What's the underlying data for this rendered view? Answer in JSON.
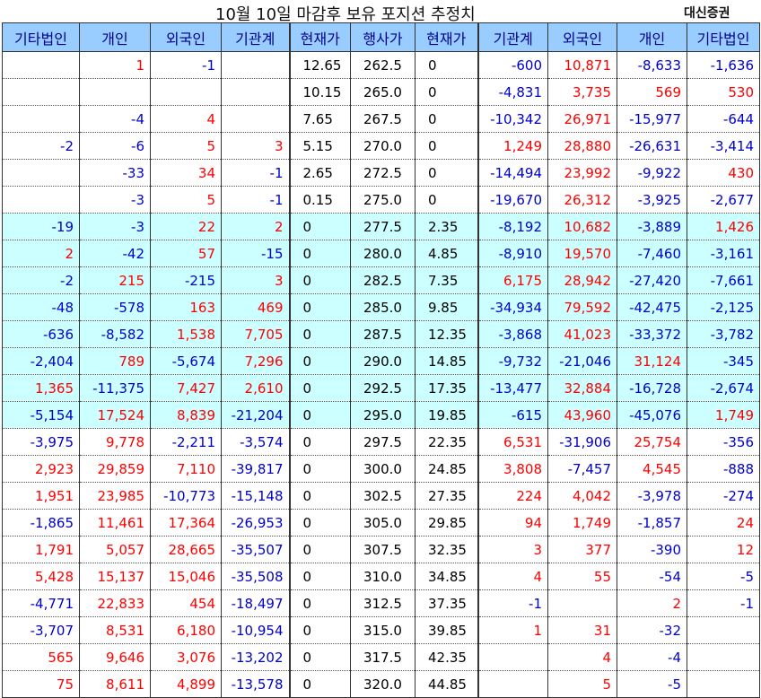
{
  "title": "10월 10일 마감후 보유 포지션 추정치",
  "source": "대신증권",
  "colors": {
    "header_bg": "#99ccff",
    "highlight_bg": "#ccffff",
    "positive": "#ff0000",
    "negative": "#0000cc"
  },
  "headers": [
    "기타법인",
    "개인",
    "외국인",
    "기관계",
    "현재가",
    "행사가",
    "현재가",
    "기관계",
    "외국인",
    "개인",
    "기타법인"
  ],
  "rows": [
    {
      "hl": false,
      "cells": [
        "",
        "1",
        "-1",
        "",
        "12.65",
        "262.5",
        "0",
        "-600",
        "10,871",
        "-8,633",
        "-1,636"
      ]
    },
    {
      "hl": false,
      "cells": [
        "",
        "",
        "",
        "",
        "10.15",
        "265.0",
        "0",
        "-4,831",
        "3,735",
        "569",
        "530"
      ]
    },
    {
      "hl": false,
      "cells": [
        "",
        "-4",
        "4",
        "",
        "7.65",
        "267.5",
        "0",
        "-10,342",
        "26,971",
        "-15,977",
        "-644"
      ]
    },
    {
      "hl": false,
      "cells": [
        "-2",
        "-6",
        "5",
        "3",
        "5.15",
        "270.0",
        "0",
        "1,249",
        "28,880",
        "-26,631",
        "-3,414"
      ]
    },
    {
      "hl": false,
      "cells": [
        "",
        "-33",
        "34",
        "-1",
        "2.65",
        "272.5",
        "0",
        "-14,494",
        "23,992",
        "-9,922",
        "430"
      ]
    },
    {
      "hl": false,
      "cells": [
        "",
        "-3",
        "5",
        "-1",
        "0.15",
        "275.0",
        "0",
        "-19,670",
        "26,312",
        "-3,925",
        "-2,677"
      ]
    },
    {
      "hl": true,
      "cells": [
        "-19",
        "-3",
        "22",
        "2",
        "0",
        "277.5",
        "2.35",
        "-8,192",
        "10,682",
        "-3,889",
        "1,426"
      ]
    },
    {
      "hl": true,
      "cells": [
        "2",
        "-42",
        "57",
        "-15",
        "0",
        "280.0",
        "4.85",
        "-8,910",
        "19,570",
        "-7,460",
        "-3,161"
      ]
    },
    {
      "hl": true,
      "cells": [
        "-2",
        "215",
        "-215",
        "3",
        "0",
        "282.5",
        "7.35",
        "6,175",
        "28,942",
        "-27,420",
        "-7,661"
      ]
    },
    {
      "hl": true,
      "cells": [
        "-48",
        "-578",
        "163",
        "469",
        "0",
        "285.0",
        "9.85",
        "-34,934",
        "79,592",
        "-42,475",
        "-2,125"
      ]
    },
    {
      "hl": true,
      "cells": [
        "-636",
        "-8,582",
        "1,538",
        "7,705",
        "0",
        "287.5",
        "12.35",
        "-3,868",
        "41,023",
        "-33,372",
        "-3,782"
      ]
    },
    {
      "hl": true,
      "cells": [
        "-2,404",
        "789",
        "-5,674",
        "7,296",
        "0",
        "290.0",
        "14.85",
        "-9,732",
        "-21,046",
        "31,124",
        "-345"
      ]
    },
    {
      "hl": true,
      "cells": [
        "1,365",
        "-11,375",
        "7,427",
        "2,610",
        "0",
        "292.5",
        "17.35",
        "-13,477",
        "32,884",
        "-16,728",
        "-2,674"
      ]
    },
    {
      "hl": true,
      "cells": [
        "-5,154",
        "17,524",
        "8,839",
        "-21,204",
        "0",
        "295.0",
        "19.85",
        "-615",
        "43,960",
        "-45,076",
        "1,749"
      ]
    },
    {
      "hl": false,
      "cells": [
        "-3,975",
        "9,778",
        "-2,211",
        "-3,574",
        "0",
        "297.5",
        "22.35",
        "6,531",
        "-31,906",
        "25,754",
        "-356"
      ]
    },
    {
      "hl": false,
      "cells": [
        "2,923",
        "29,859",
        "7,110",
        "-39,817",
        "0",
        "300.0",
        "24.85",
        "3,808",
        "-7,457",
        "4,545",
        "-888"
      ]
    },
    {
      "hl": false,
      "cells": [
        "1,951",
        "23,985",
        "-10,773",
        "-15,148",
        "0",
        "302.5",
        "27.35",
        "224",
        "4,042",
        "-3,978",
        "-274"
      ]
    },
    {
      "hl": false,
      "cells": [
        "-1,865",
        "11,461",
        "17,364",
        "-26,953",
        "0",
        "305.0",
        "29.85",
        "94",
        "1,749",
        "-1,857",
        "24"
      ]
    },
    {
      "hl": false,
      "cells": [
        "1,791",
        "5,057",
        "28,665",
        "-35,507",
        "0",
        "307.5",
        "32.35",
        "3",
        "377",
        "-390",
        "12"
      ]
    },
    {
      "hl": false,
      "cells": [
        "5,428",
        "15,137",
        "15,046",
        "-35,508",
        "0",
        "310.0",
        "34.85",
        "4",
        "55",
        "-54",
        "-5"
      ]
    },
    {
      "hl": false,
      "cells": [
        "-4,771",
        "22,833",
        "454",
        "-18,497",
        "0",
        "312.5",
        "37.35",
        "-1",
        "",
        "2",
        "-1"
      ]
    },
    {
      "hl": false,
      "cells": [
        "-3,707",
        "8,531",
        "6,180",
        "-10,954",
        "0",
        "315.0",
        "39.85",
        "1",
        "31",
        "-32",
        ""
      ]
    },
    {
      "hl": false,
      "cells": [
        "565",
        "9,646",
        "3,076",
        "-13,202",
        "0",
        "317.5",
        "42.35",
        "",
        "4",
        "-4",
        ""
      ]
    },
    {
      "hl": false,
      "cells": [
        "75",
        "8,611",
        "4,899",
        "-13,578",
        "0",
        "320.0",
        "44.85",
        "",
        "5",
        "-5",
        ""
      ]
    }
  ]
}
